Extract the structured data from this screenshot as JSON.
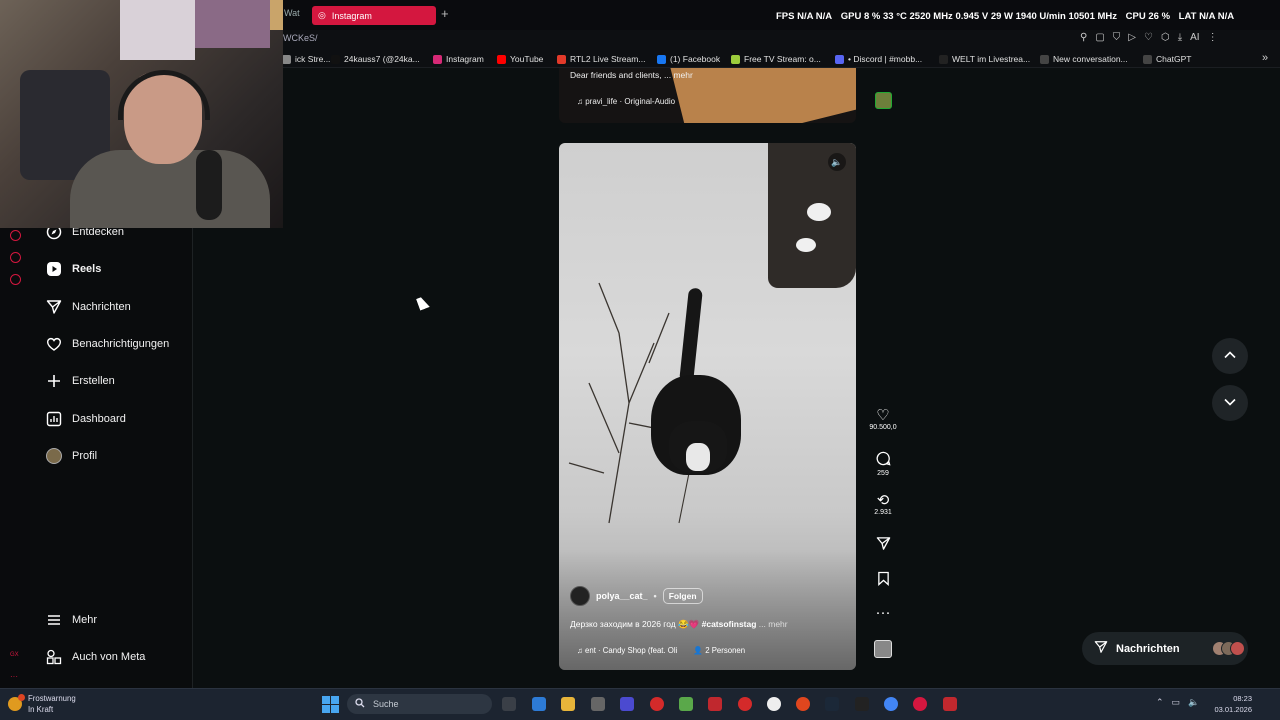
{
  "browser": {
    "tabs": [
      {
        "label": "Wat"
      },
      {
        "label": "Instagram",
        "active": true
      }
    ],
    "url": "WCKeS/",
    "bookmarks": [
      {
        "label": "ick Stre...",
        "color": "#888888"
      },
      {
        "label": "24kauss7 (@24ka...",
        "color": "#111111"
      },
      {
        "label": "Instagram",
        "color": "#d62976"
      },
      {
        "label": "YouTube",
        "color": "#ff0000"
      },
      {
        "label": "RTL2 Live Stream...",
        "color": "#e23a2a"
      },
      {
        "label": "(1) Facebook",
        "color": "#1877f2"
      },
      {
        "label": "Free TV Stream: o...",
        "color": "#9ccc3c"
      },
      {
        "label": "• Discord | #mobb...",
        "color": "#5865f2"
      },
      {
        "label": "WELT im Livestrea...",
        "color": "#222222"
      },
      {
        "label": "New conversation...",
        "color": "#444444"
      },
      {
        "label": "ChatGPT",
        "color": "#444444"
      }
    ]
  },
  "hw_stats": {
    "fps": "FPS  N/A  N/A",
    "gpu": "GPU  8 %  33 °C  2520 MHz  0.945 V  29 W  1940 U/min  10501 MHz",
    "cpu": "CPU  26 %",
    "lat": "LAT  N/A  N/A"
  },
  "sidebar": {
    "items": [
      {
        "label": "Entdecken",
        "icon": "compass-icon"
      },
      {
        "label": "Reels",
        "icon": "reels-icon"
      },
      {
        "label": "Nachrichten",
        "icon": "send-icon"
      },
      {
        "label": "Benachrichtigungen",
        "icon": "heart-icon"
      },
      {
        "label": "Erstellen",
        "icon": "plus-icon"
      },
      {
        "label": "Dashboard",
        "icon": "dashboard-icon"
      },
      {
        "label": "Profil",
        "icon": "avatar"
      }
    ],
    "more_label": "Mehr",
    "meta_label": "Auch von Meta"
  },
  "prev_reel": {
    "caption": "Dear friends and clients, ... mehr",
    "audio": "pravi_life · Original-Audio"
  },
  "reel": {
    "username": "polya__cat_",
    "follow_label": "Folgen",
    "caption_text": "Дерзко заходим в 2026 год 😂💗",
    "caption_tag": "#catsofinstag",
    "caption_more": "... mehr",
    "audio": "ent · Candy Shop (feat. Oli",
    "people": "2 Personen"
  },
  "actions": {
    "likes": "90.500,0",
    "comments": "259",
    "reposts": "2.931"
  },
  "messages_pill": {
    "label": "Nachrichten"
  },
  "taskbar": {
    "weather_title": "Frostwarnung",
    "weather_sub": "In Kraft",
    "search_placeholder": "Suche",
    "time": "08:23",
    "date": "03.01.2026"
  },
  "colors": {
    "accent": "#d4173f",
    "background": "#0b0f10"
  }
}
